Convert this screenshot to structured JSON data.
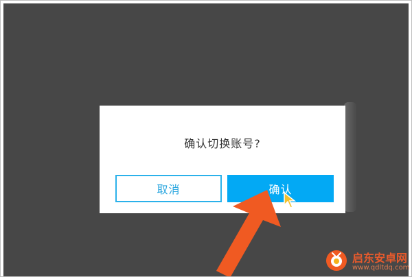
{
  "dialog": {
    "message": "确认切换账号?",
    "cancel_label": "取消",
    "confirm_label": "确认"
  },
  "watermark": {
    "name": "启东安卓网",
    "url": "www.qdltdq.com"
  },
  "colors": {
    "overlay": "#474747",
    "accent": "#03a9f4",
    "arrow": "#f05a22"
  },
  "icons": {
    "cursor": "pointer-cursor-icon",
    "arrow": "pointing-arrow-icon",
    "logo": "watermark-logo-icon"
  }
}
